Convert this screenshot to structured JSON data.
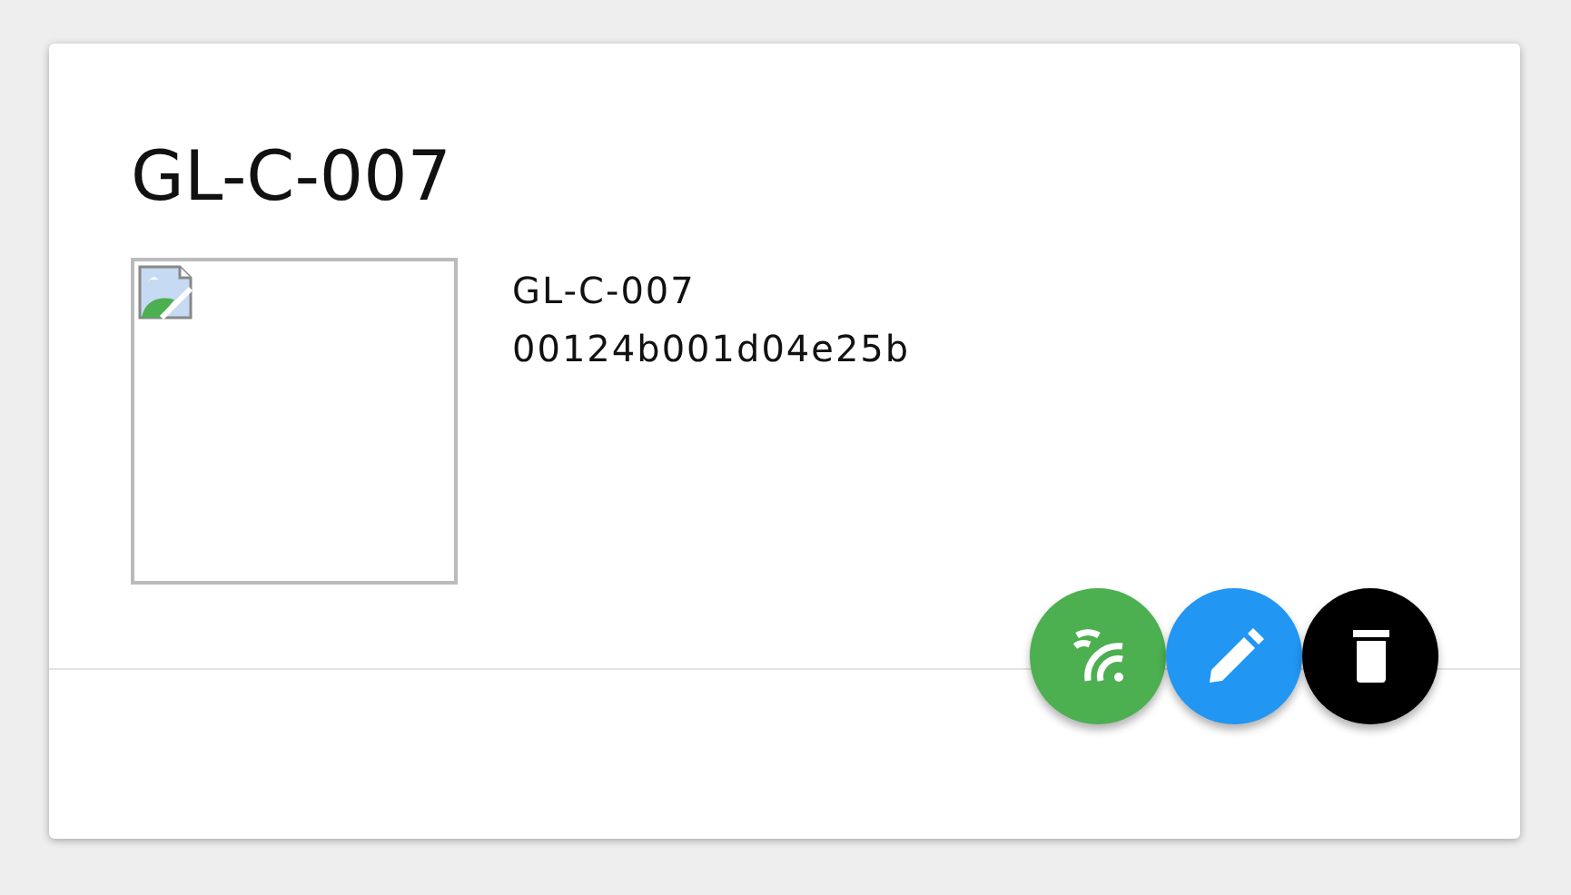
{
  "card": {
    "title": "GL-C-007",
    "name": "GL-C-007",
    "address": "00124b001d04e25b",
    "image": {
      "kind": "broken"
    },
    "actions": [
      {
        "kind": "signal",
        "color": "#4caf50"
      },
      {
        "kind": "edit",
        "color": "#2196f3"
      },
      {
        "kind": "delete",
        "color": "#000000"
      }
    ]
  }
}
